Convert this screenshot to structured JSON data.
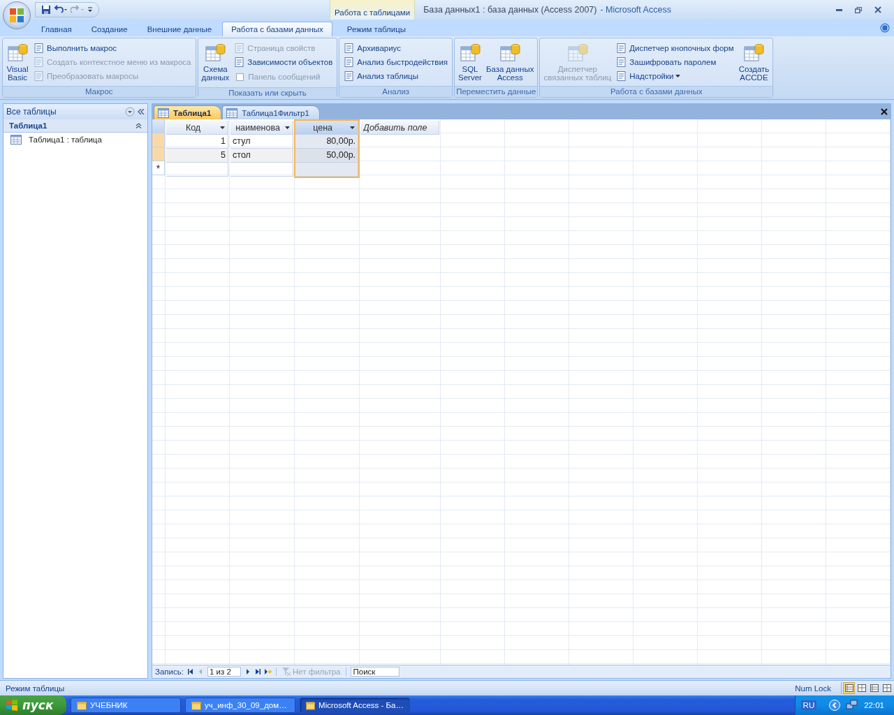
{
  "window": {
    "context_label": "Работа с таблицами",
    "title_document": "База данных1 : база данных (Access 2007)",
    "title_app": "- Microsoft Access"
  },
  "ribbon": {
    "tabs": [
      {
        "label": "Главная",
        "selected": false,
        "kind": "standard"
      },
      {
        "label": "Создание",
        "selected": false,
        "kind": "standard"
      },
      {
        "label": "Внешние данные",
        "selected": false,
        "kind": "standard"
      },
      {
        "label": "Работа с базами данных",
        "selected": true,
        "kind": "standard"
      },
      {
        "label": "Режим таблицы",
        "selected": false,
        "kind": "contextual"
      }
    ],
    "groups": [
      {
        "label": "Макрос",
        "items": [
          {
            "kind": "large",
            "label": "Visual\nBasic",
            "disabled": false
          },
          {
            "kind": "small",
            "label": "Выполнить макрос",
            "disabled": false
          },
          {
            "kind": "small",
            "label": "Создать контекстное меню из макроса",
            "disabled": true
          },
          {
            "kind": "small",
            "label": "Преобразовать макросы",
            "disabled": true
          }
        ]
      },
      {
        "label": "Показать или скрыть",
        "items": [
          {
            "kind": "large",
            "label": "Схема\nданных",
            "disabled": false
          },
          {
            "kind": "small",
            "label": "Страница свойств",
            "disabled": true
          },
          {
            "kind": "small",
            "label": "Зависимости объектов",
            "disabled": false
          },
          {
            "kind": "checkbox",
            "label": "Панель сообщений",
            "disabled": true,
            "checked": false
          }
        ]
      },
      {
        "label": "Анализ",
        "items": [
          {
            "kind": "small",
            "label": "Архивариус",
            "disabled": false
          },
          {
            "kind": "small",
            "label": "Анализ быстродействия",
            "disabled": false
          },
          {
            "kind": "small",
            "label": "Анализ таблицы",
            "disabled": false
          }
        ]
      },
      {
        "label": "Переместить данные",
        "items": [
          {
            "kind": "large",
            "label": "SQL\nServer",
            "disabled": false
          },
          {
            "kind": "large",
            "label": "База данных\nAccess",
            "disabled": false
          }
        ]
      },
      {
        "label": "Работа с базами данных",
        "items": [
          {
            "kind": "large",
            "label": "Диспетчер\nсвязанных таблиц",
            "disabled": true
          },
          {
            "kind": "small",
            "label": "Диспетчер кнопочных форм",
            "disabled": false
          },
          {
            "kind": "small",
            "label": "Зашифровать паролем",
            "disabled": false
          },
          {
            "kind": "dropdown",
            "label": "Надстройки",
            "disabled": false
          },
          {
            "kind": "large",
            "label": "Создать\nACCDE",
            "disabled": false
          }
        ]
      }
    ]
  },
  "nav_pane": {
    "title": "Все таблицы",
    "groups": [
      {
        "label": "Таблица1",
        "expanded": true,
        "items": [
          {
            "label": "Таблица1 : таблица"
          }
        ]
      }
    ]
  },
  "document_tabs": [
    {
      "label": "Таблица1",
      "selected": true
    },
    {
      "label": "Таблица1Фильтр1",
      "selected": false
    }
  ],
  "table": {
    "columns": [
      {
        "label": "Код",
        "kind": "number",
        "selected": false
      },
      {
        "label": "наименова",
        "kind": "text",
        "selected": false
      },
      {
        "label": "цена",
        "kind": "number",
        "selected": true
      },
      {
        "label": "Добавить поле",
        "kind": "add",
        "selected": false
      }
    ],
    "rows": [
      {
        "cells": [
          "1",
          "стул",
          "80,00р."
        ]
      },
      {
        "cells": [
          "5",
          "стол",
          "50,00р."
        ]
      }
    ],
    "new_row_marker": "*"
  },
  "record_navigator": {
    "label": "Запись:",
    "position": "1 из 2",
    "filter": "Нет фильтра",
    "search_placeholder": "Поиск"
  },
  "status_bar": {
    "mode": "Режим таблицы",
    "num_lock": "Num Lock",
    "views": [
      {
        "selected": true
      },
      {
        "selected": false
      },
      {
        "selected": false
      },
      {
        "selected": false
      }
    ]
  },
  "taskbar": {
    "start": "пуск",
    "tasks": [
      {
        "label": "УЧЕБНИК",
        "selected": false
      },
      {
        "label": "уч_инф_30_09_дом…",
        "selected": false
      },
      {
        "label": "Microsoft Access - Ба…",
        "selected": true
      }
    ],
    "language": "RU",
    "time": "22:01"
  }
}
